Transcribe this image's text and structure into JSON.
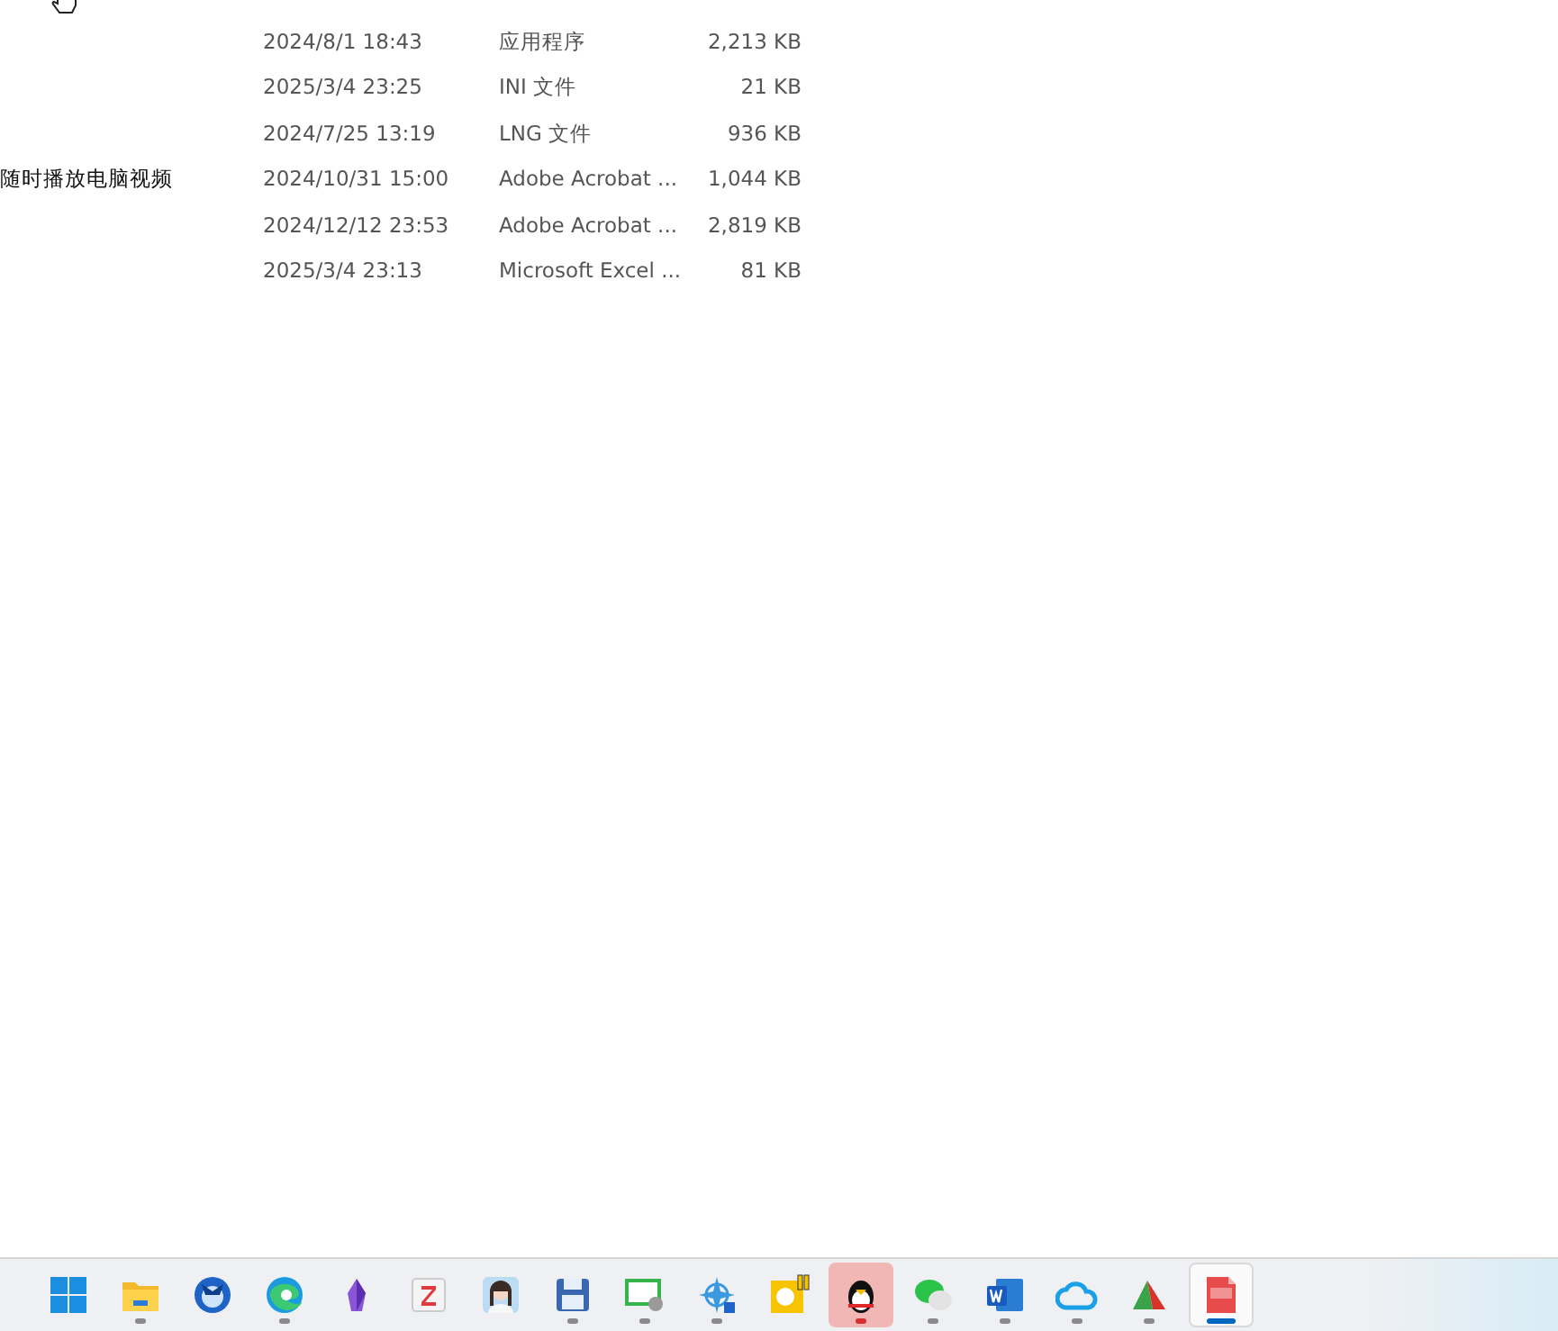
{
  "files": [
    {
      "date": "2024/8/1 18:43",
      "type": "应用程序",
      "size": "2,213 KB"
    },
    {
      "date": "2025/3/4 23:25",
      "type": "INI 文件",
      "size": "21 KB"
    },
    {
      "date": "2024/7/25 13:19",
      "type": "LNG 文件",
      "size": "936 KB"
    },
    {
      "name": "随时播放电脑视频",
      "date": "2024/10/31 15:00",
      "type": "Adobe Acrobat ...",
      "size": "1,044 KB"
    },
    {
      "date": "2024/12/12 23:53",
      "type": "Adobe Acrobat ...",
      "size": "2,819 KB"
    },
    {
      "date": "2025/3/4 23:13",
      "type": "Microsoft Excel ...",
      "size": "81 KB"
    }
  ],
  "taskbar": [
    {
      "kind": "start",
      "running": false,
      "selected": false
    },
    {
      "kind": "folder",
      "running": true,
      "selected": false
    },
    {
      "kind": "bird",
      "running": false,
      "selected": false
    },
    {
      "kind": "browser",
      "running": true,
      "selected": false
    },
    {
      "kind": "crystal",
      "running": false,
      "selected": false
    },
    {
      "kind": "notepad",
      "running": false,
      "selected": false
    },
    {
      "kind": "avatar",
      "running": false,
      "selected": false
    },
    {
      "kind": "floppy",
      "running": true,
      "selected": false
    },
    {
      "kind": "monitor",
      "running": true,
      "selected": false
    },
    {
      "kind": "compass",
      "running": true,
      "selected": false
    },
    {
      "kind": "player",
      "running": false,
      "selected": false
    },
    {
      "kind": "penguin",
      "running": true,
      "selected": false,
      "attention": true
    },
    {
      "kind": "chat",
      "running": true,
      "selected": false
    },
    {
      "kind": "doc",
      "running": true,
      "selected": false
    },
    {
      "kind": "cloud",
      "running": true,
      "selected": false
    },
    {
      "kind": "tent",
      "running": true,
      "selected": false
    },
    {
      "kind": "gif",
      "running": true,
      "selected": true
    }
  ]
}
